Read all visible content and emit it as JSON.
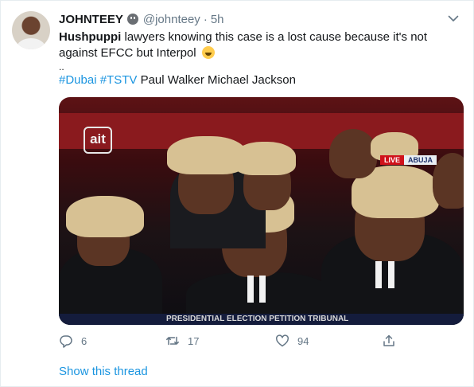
{
  "tweet": {
    "display_name": "JOHNTEEY",
    "handle": "@johnteey",
    "separator": "·",
    "time": "5h",
    "text_bold": "Hushpuppi",
    "text_rest": " lawyers knowing this case is a lost cause because it's not against EFCC but Interpol",
    "dots": "..",
    "hashtags": [
      "#Dubai",
      "#TSTV"
    ],
    "text_tail": " Paul Walker Michael Jackson",
    "icons": {
      "verified_face": "neutral-face-icon",
      "laugh": "face-with-tears-of-joy-icon",
      "more": "chevron-down-icon"
    }
  },
  "media": {
    "channel_logo": "ait",
    "live_tag": "LIVE",
    "location": "ABUJA",
    "ticker": "PRESIDENTIAL ELECTION PETITION TRIBUNAL"
  },
  "actions": {
    "reply_count": "6",
    "retweet_count": "17",
    "like_count": "94"
  },
  "thread_link": "Show this thread",
  "colors": {
    "link": "#1b95e0",
    "secondary_text": "#657786",
    "primary_text": "#14171a"
  }
}
